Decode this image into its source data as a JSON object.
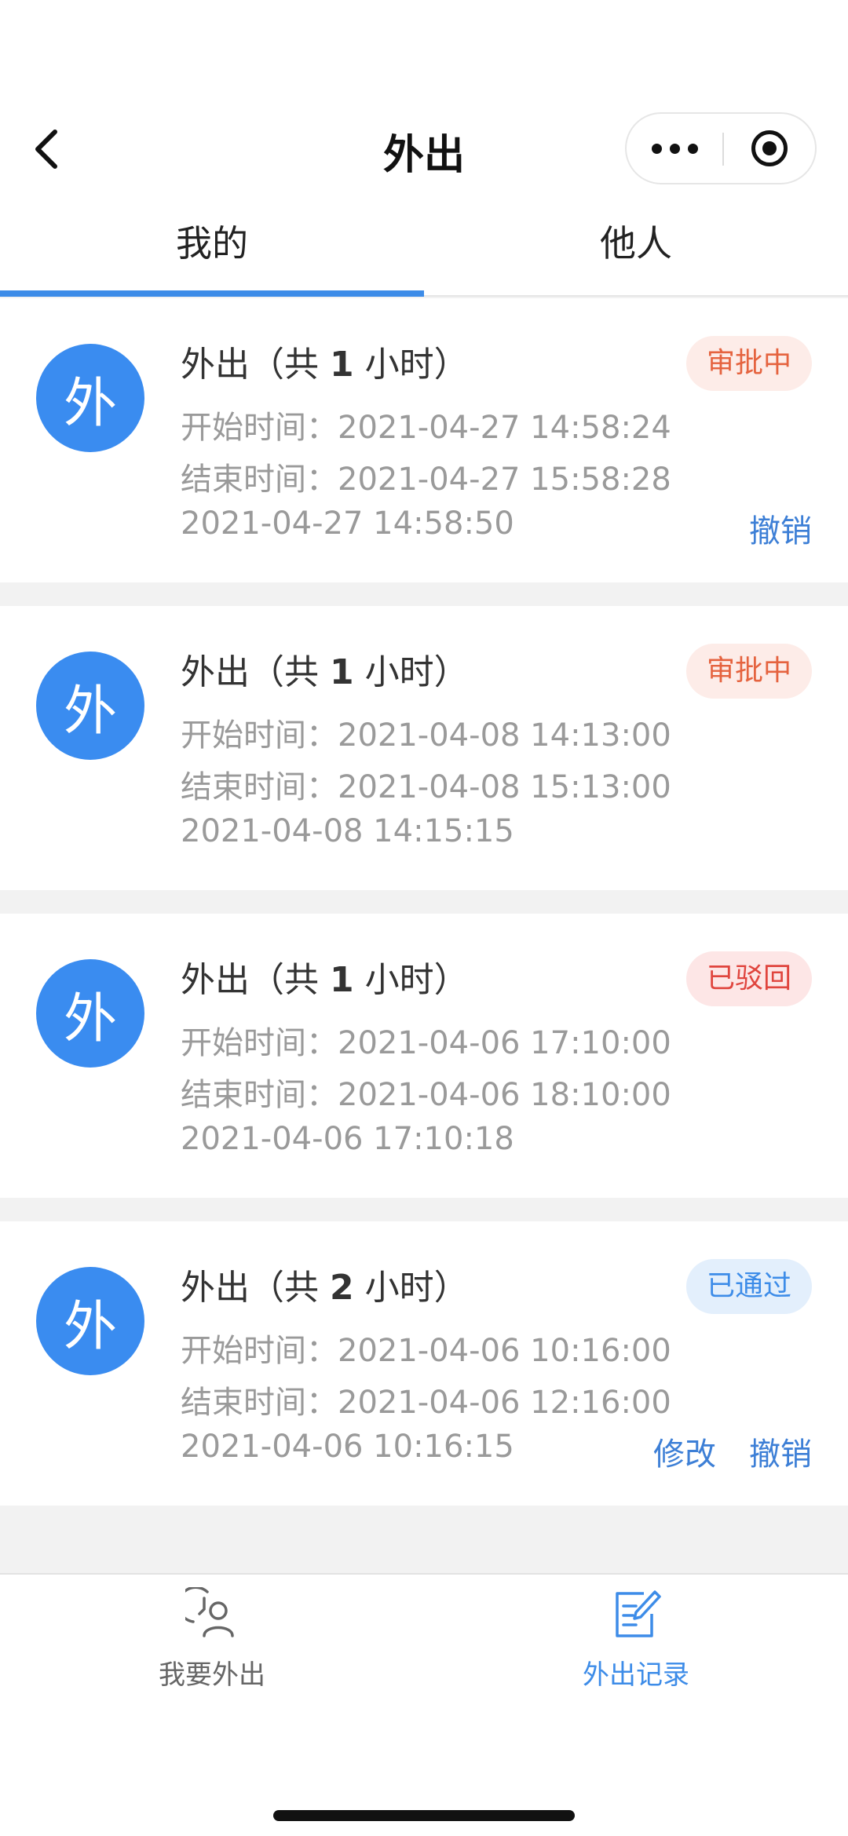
{
  "header": {
    "title": "外出"
  },
  "tabs": [
    {
      "label": "我的"
    },
    {
      "label": "他人"
    }
  ],
  "colors": {
    "accent": "#3d8ce8",
    "avatar": "#3a8cf0",
    "pending_text": "#e5633f",
    "pending_bg": "#fdece8",
    "rejected_text": "#e0453e",
    "rejected_bg": "#fde6e6",
    "approved_text": "#3d8ce8",
    "approved_bg": "#e3effc"
  },
  "records": [
    {
      "avatar": "外",
      "title_prefix": "外出（共 ",
      "hours": "1",
      "title_suffix": " 小时）",
      "start_label": "开始时间：",
      "start": "2021-04-27 14:58:24",
      "end_label": "结束时间：",
      "end": "2021-04-27 15:58:28",
      "created": "2021-04-27 14:58:50",
      "status": "审批中",
      "actions": [
        "撤销"
      ]
    },
    {
      "avatar": "外",
      "title_prefix": "外出（共 ",
      "hours": "1",
      "title_suffix": " 小时）",
      "start_label": "开始时间：",
      "start": "2021-04-08 14:13:00",
      "end_label": "结束时间：",
      "end": "2021-04-08 15:13:00",
      "created": "2021-04-08 14:15:15",
      "status": "审批中",
      "actions": []
    },
    {
      "avatar": "外",
      "title_prefix": "外出（共 ",
      "hours": "1",
      "title_suffix": " 小时）",
      "start_label": "开始时间：",
      "start": "2021-04-06 17:10:00",
      "end_label": "结束时间：",
      "end": "2021-04-06 18:10:00",
      "created": "2021-04-06 17:10:18",
      "status": "已驳回",
      "actions": []
    },
    {
      "avatar": "外",
      "title_prefix": "外出（共 ",
      "hours": "2",
      "title_suffix": " 小时）",
      "start_label": "开始时间：",
      "start": "2021-04-06 10:16:00",
      "end_label": "结束时间：",
      "end": "2021-04-06 12:16:00",
      "created": "2021-04-06 10:16:15",
      "status": "已通过",
      "actions": [
        "修改",
        "撤销"
      ]
    }
  ],
  "tabbar": [
    {
      "label": "我要外出",
      "icon": "person-clock-icon",
      "color": "#666666"
    },
    {
      "label": "外出记录",
      "icon": "edit-record-icon",
      "color": "#3d8ce8"
    }
  ]
}
